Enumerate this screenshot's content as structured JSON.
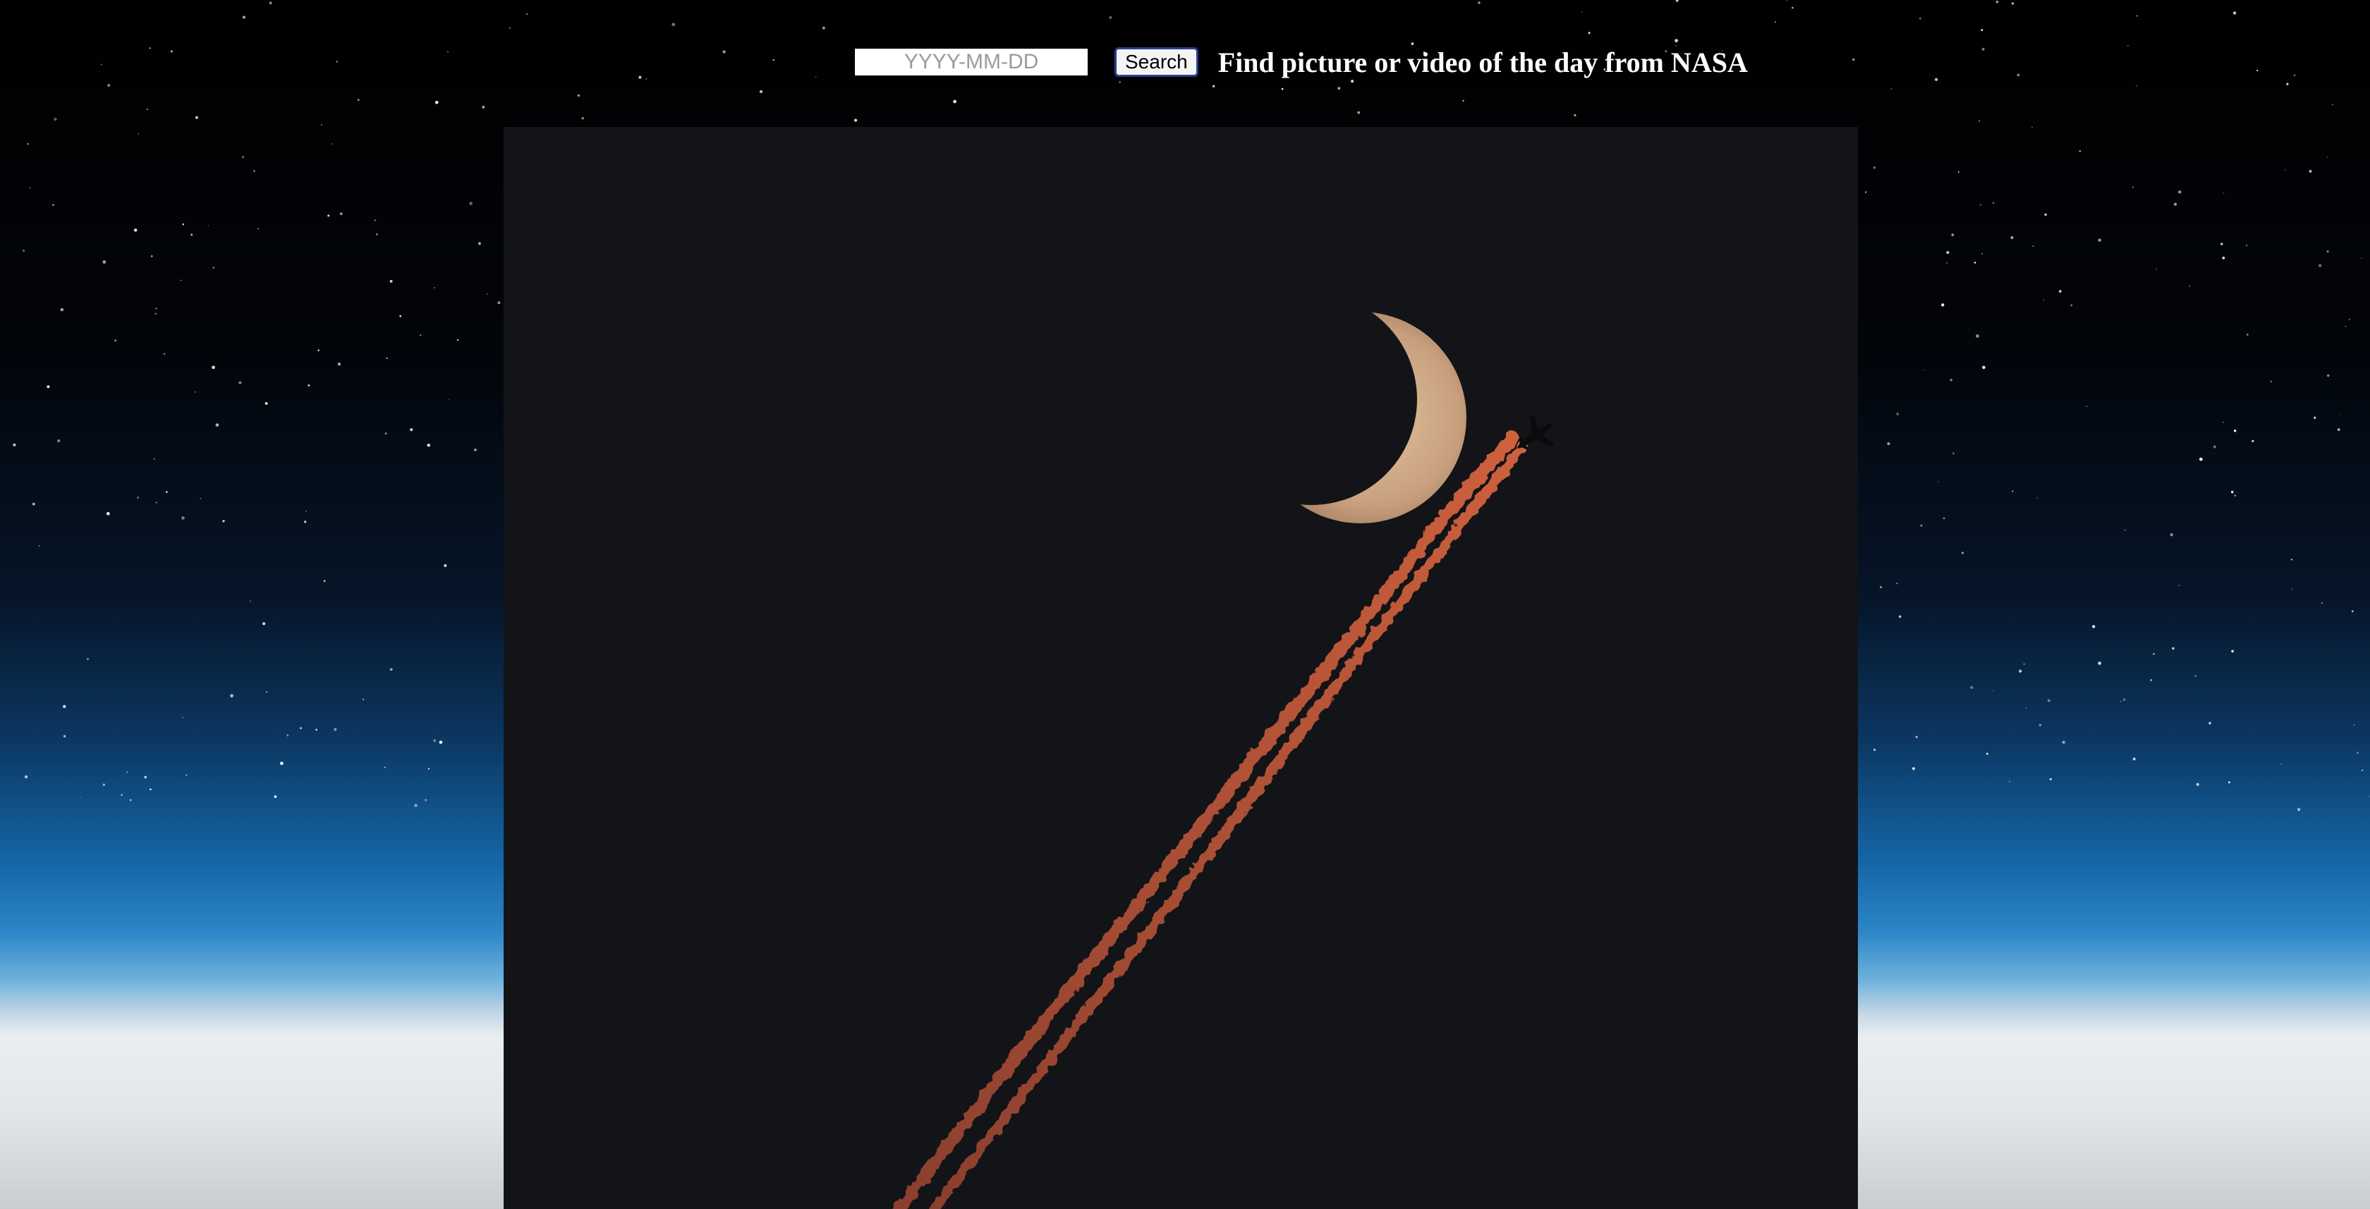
{
  "search": {
    "placeholder": "YYYY-MM-DD",
    "button_label": "Search",
    "heading": "Find picture or video of the day from NASA"
  },
  "apod": {
    "subject": "crescent-moon-airplane-contrail"
  },
  "colors": {
    "page_background": "#000000",
    "image_background": "#121417",
    "contrail": "#c05a3a",
    "moon": "#d7b18e",
    "button_border": "#2a3d8f"
  }
}
